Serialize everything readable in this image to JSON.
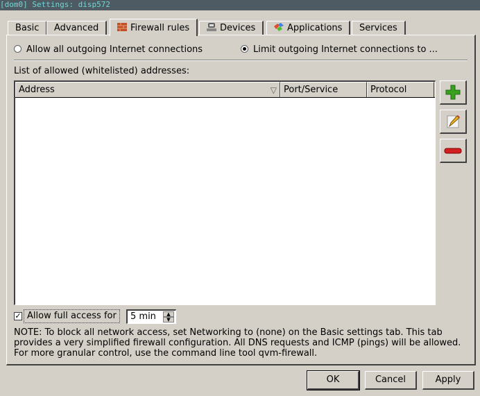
{
  "window": {
    "title": "[dom0] Settings: disp572"
  },
  "tabs": [
    {
      "label": "Basic",
      "icon": null,
      "active": false
    },
    {
      "label": "Advanced",
      "icon": null,
      "active": false
    },
    {
      "label": "Firewall rules",
      "icon": "firewall-brick-icon",
      "active": true
    },
    {
      "label": "Devices",
      "icon": "devices-icon",
      "active": false
    },
    {
      "label": "Applications",
      "icon": "applications-icon",
      "active": false
    },
    {
      "label": "Services",
      "icon": null,
      "active": false
    }
  ],
  "firewall": {
    "radio_allow_all": {
      "label": "Allow all outgoing Internet connections",
      "selected": false
    },
    "radio_limit": {
      "label": "Limit outgoing Internet connections to ...",
      "selected": true
    },
    "list_label": "List of allowed (whitelisted) addresses:",
    "columns": [
      "Address",
      "Port/Service",
      "Protocol"
    ],
    "sort_column": "Address",
    "sort_indicator": "▽",
    "rows": [],
    "side_buttons": [
      {
        "name": "add",
        "icon": "plus-icon"
      },
      {
        "name": "edit",
        "icon": "pencil-icon"
      },
      {
        "name": "remove",
        "icon": "minus-icon"
      }
    ],
    "full_access": {
      "label": "Allow full access for",
      "checked": true,
      "check_glyph": "✓",
      "duration": "5 min"
    },
    "note": "NOTE:  To block all network access, set Networking to (none) on the Basic settings tab. This tab provides a very simplified firewall configuration. All DNS requests and ICMP (pings) will be allowed. For more granular control, use the command line tool qvm-firewall."
  },
  "buttons": {
    "ok": "OK",
    "cancel": "Cancel",
    "apply": "Apply"
  }
}
